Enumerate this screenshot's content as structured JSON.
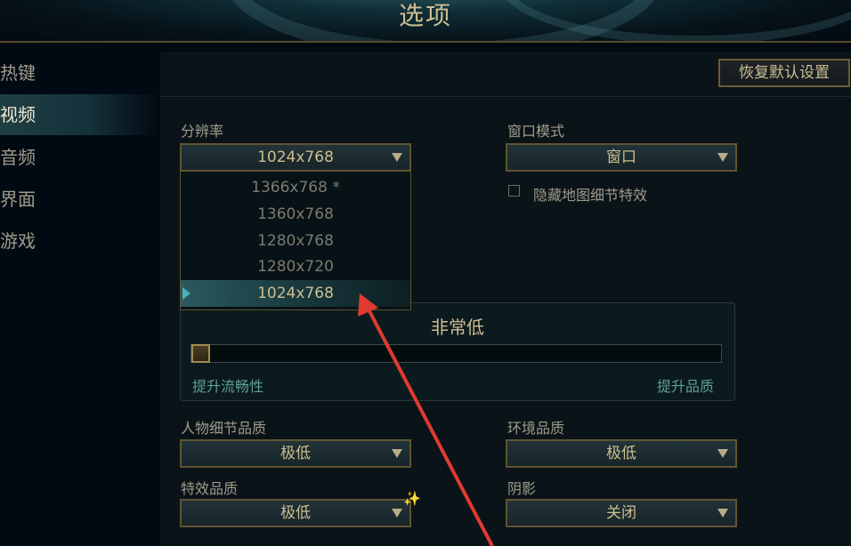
{
  "header": {
    "title": "选项"
  },
  "sidebar": {
    "items": [
      {
        "label": "热键"
      },
      {
        "label": "视频"
      },
      {
        "label": "音频"
      },
      {
        "label": "界面"
      },
      {
        "label": "游戏"
      }
    ],
    "active_index": 1
  },
  "toolbar": {
    "reset_label": "恢复默认设置"
  },
  "resolution": {
    "label": "分辨率",
    "value": "1024x768",
    "options": [
      "1366x768 *",
      "1360x768",
      "1280x768",
      "1280x720",
      "1024x768"
    ],
    "selected_index": 4
  },
  "window_mode": {
    "label": "窗口模式",
    "value": "窗口",
    "hide_map_effects_label": "隐藏地图细节特效",
    "hide_map_effects_checked": false
  },
  "graphics": {
    "quality_label": "非常低",
    "left_hint": "提升流畅性",
    "right_hint": "提升品质",
    "slider_level": 0
  },
  "character_quality": {
    "label": "人物细节品质",
    "value": "极低"
  },
  "environment_quality": {
    "label": "环境品质",
    "value": "极低"
  },
  "effects_quality": {
    "label": "特效品质",
    "value": "极低"
  },
  "shadows": {
    "label": "阴影",
    "value": "关闭"
  },
  "colors": {
    "gold": "#cdbe91",
    "text": "#a09b8c",
    "teal_hint": "#5f9e97",
    "annotation_arrow": "#e03a32"
  }
}
